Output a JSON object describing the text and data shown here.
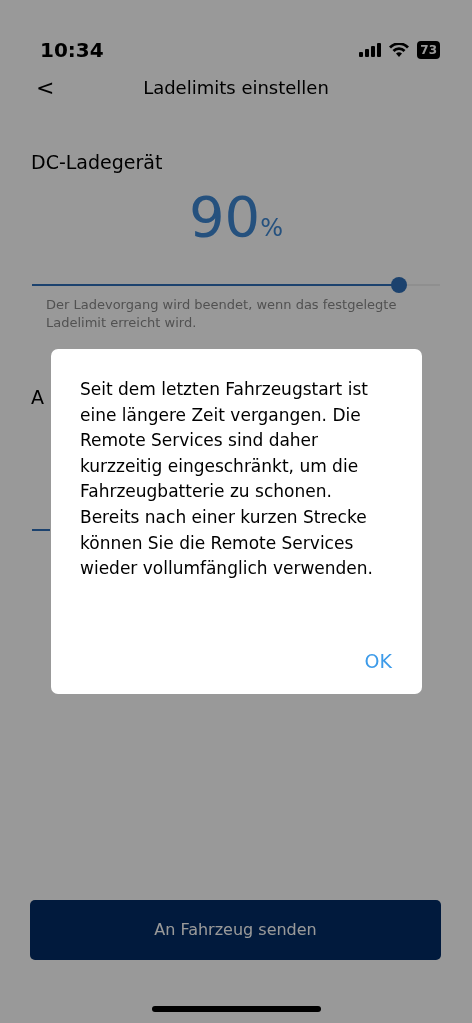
{
  "status_bar": {
    "time": "10:34",
    "battery": "73"
  },
  "header": {
    "back": "<",
    "title": "Ladelimits einstellen"
  },
  "dc_section": {
    "label": "DC-Ladegerät",
    "value": "90",
    "unit": "%",
    "slider": {
      "level": 0.9
    },
    "description": "Der Ladevorgang wird beendet, wenn das festgelegte Ladelimit erreicht wird."
  },
  "ac_section": {
    "label": "A"
  },
  "send_button": "An Fahrzeug senden",
  "dialog": {
    "message": "Seit dem letzten Fahrzeugstart ist eine längere Zeit vergangen. Die Remote Services sind daher kurzzeitig eingeschränkt, um die Fahrzeugbatterie zu schonen. Bereits nach einer kurzen Strecke können Sie die Remote Services wieder vollumfänglich verwenden.",
    "button": "OK"
  }
}
